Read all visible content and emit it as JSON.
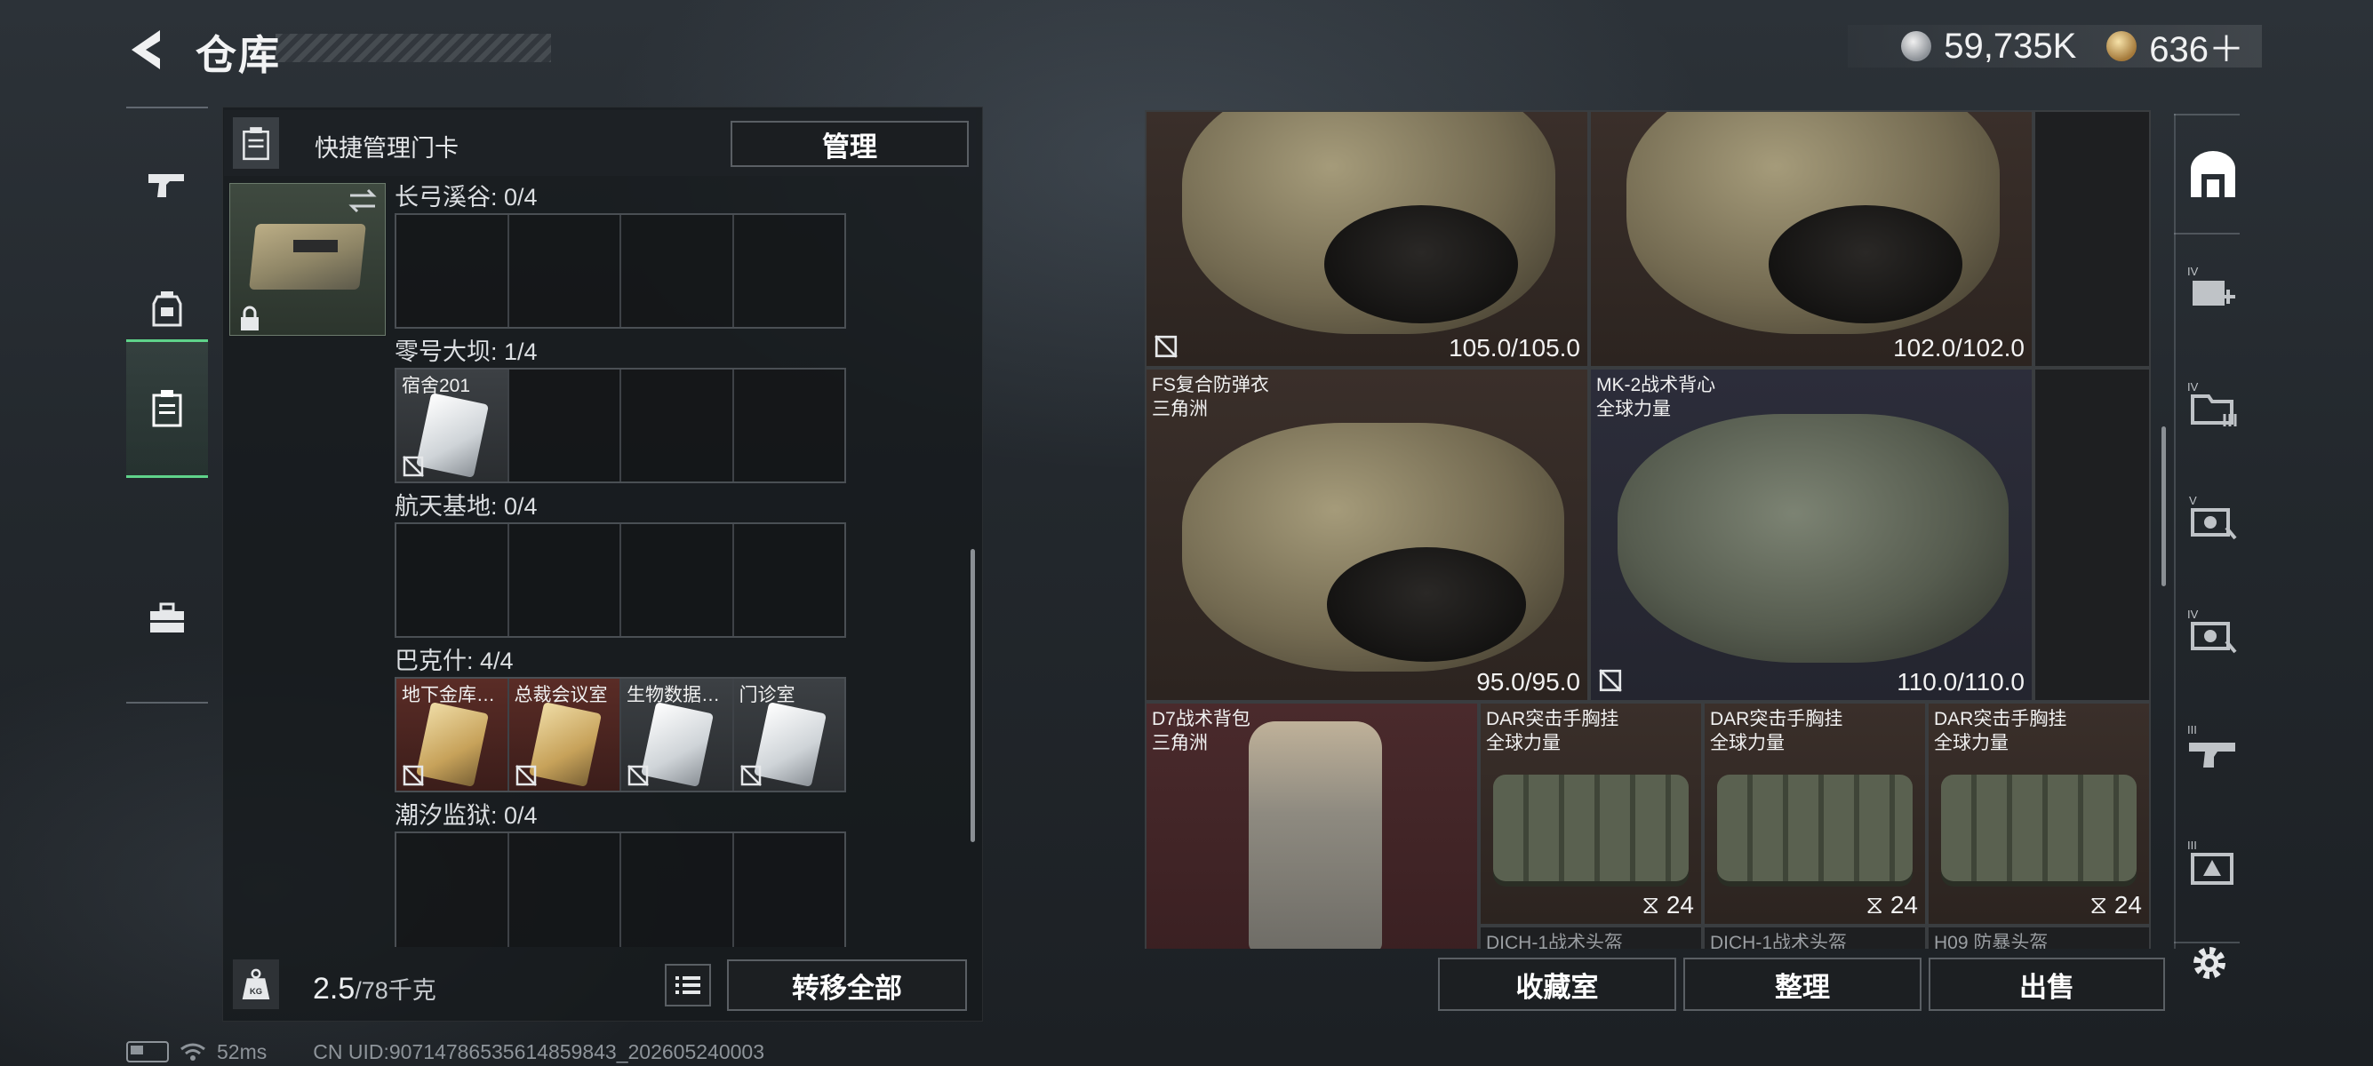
{
  "header": {
    "title": "仓库",
    "currency_1": "59,735K",
    "currency_2": "636＋"
  },
  "left_nav": [
    {
      "icon": "pistol-icon"
    },
    {
      "icon": "armor-bag-icon"
    },
    {
      "icon": "keycard-case-icon",
      "selected": true
    },
    {
      "icon": "toolbox-icon"
    }
  ],
  "keycard_panel": {
    "quick_manage_label": "快捷管理门卡",
    "manage_button": "管理",
    "sections": [
      {
        "title": "长弓溪谷: 0/4",
        "slots": [
          null,
          null,
          null,
          null
        ]
      },
      {
        "title": "零号大坝: 1/4",
        "slots": [
          {
            "name": "宿舍201",
            "color": "white"
          },
          null,
          null,
          null
        ]
      },
      {
        "title": "航天基地: 0/4",
        "slots": [
          null,
          null,
          null,
          null
        ]
      },
      {
        "title": "巴克什: 4/4",
        "slots": [
          {
            "name": "地下金库…",
            "color": "gold"
          },
          {
            "name": "总裁会议室",
            "color": "gold"
          },
          {
            "name": "生物数据…",
            "color": "white"
          },
          {
            "name": "门诊室",
            "color": "white"
          }
        ]
      },
      {
        "title": "潮汐监狱: 0/4",
        "slots": [
          null,
          null,
          null,
          null
        ]
      }
    ]
  },
  "weight": {
    "value": "2.5",
    "unit": "/78千克"
  },
  "transfer_all_button": "转移全部",
  "status_bar": {
    "ping": "52ms",
    "uid": "CN UID:90714786535614859843_202605240003"
  },
  "stash": {
    "items": [
      {
        "id": "vest-1",
        "name": "",
        "sub": "",
        "value": "105.0/105.0",
        "bg": "brown"
      },
      {
        "id": "vest-2",
        "name": "",
        "sub": "",
        "value": "102.0/102.0",
        "bg": "brown"
      },
      {
        "id": "vest-3",
        "name": "FS复合防弹衣",
        "sub": "三角洲",
        "value": "95.0/95.0",
        "bg": "brown"
      },
      {
        "id": "vest-4",
        "name": "MK-2战术背心",
        "sub": "全球力量",
        "value": "110.0/110.0",
        "bg": "blue"
      },
      {
        "id": "backpack",
        "name": "D7战术背包",
        "sub": "三角洲",
        "value": "",
        "bg": "red"
      },
      {
        "id": "rig-1",
        "name": "DAR突击手胸挂",
        "sub": "全球力量",
        "value": "24",
        "bg": "brown"
      },
      {
        "id": "rig-2",
        "name": "DAR突击手胸挂",
        "sub": "全球力量",
        "value": "24",
        "bg": "brown"
      },
      {
        "id": "rig-3",
        "name": "DAR突击手胸挂",
        "sub": "全球力量",
        "value": "24",
        "bg": "brown"
      }
    ],
    "next_row_labels": [
      "DICH-1战术头盔",
      "DICH-1战术头盔",
      "H09 防暴头盔"
    ]
  },
  "bottom_buttons": {
    "collection": "收藏室",
    "sort": "整理",
    "sell": "出售"
  },
  "right_rail": [
    {
      "icon": "home-base-icon",
      "label": ""
    },
    {
      "icon": "medkit-icon",
      "label": "IV"
    },
    {
      "icon": "folder-icon",
      "label": "IV"
    },
    {
      "icon": "camera-icon",
      "label": "V"
    },
    {
      "icon": "camera-icon",
      "label": "IV"
    },
    {
      "icon": "gun-icon",
      "label": "III"
    },
    {
      "icon": "warning-icon",
      "label": "III"
    }
  ],
  "colors": {
    "accent_green": "#5fd38a",
    "panel_bg": "#16191c",
    "gold_card": "#c7a25a",
    "white_card": "#cfd4d8"
  }
}
